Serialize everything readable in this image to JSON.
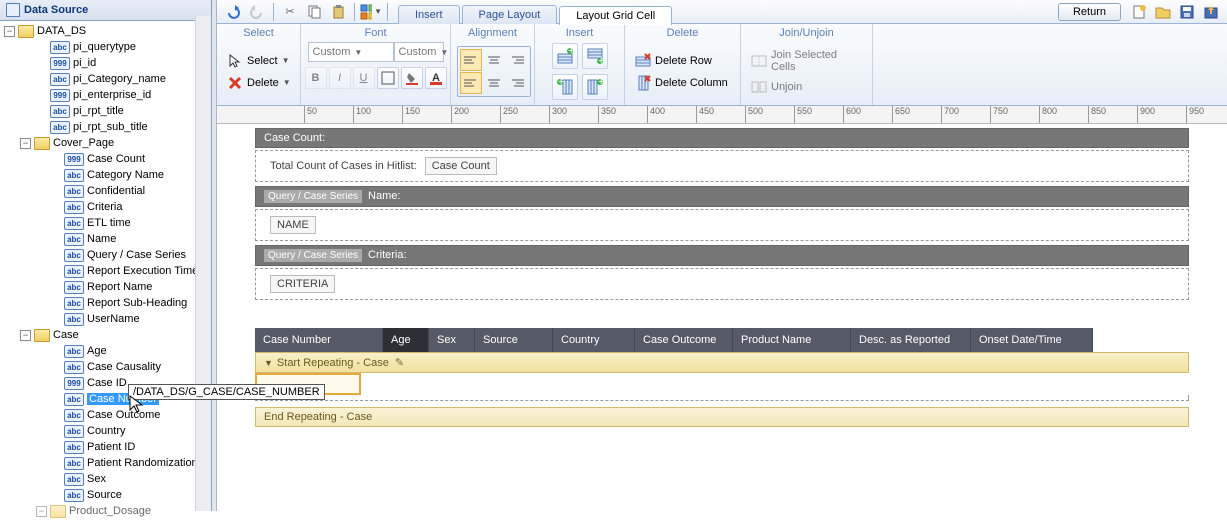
{
  "panel_title": "Data Source",
  "tree": {
    "root": "DATA_DS",
    "items_lvl1": [
      {
        "badge": "abc",
        "label": "pi_querytype"
      },
      {
        "badge": "999",
        "label": "pi_id"
      },
      {
        "badge": "abc",
        "label": "pi_Category_name"
      },
      {
        "badge": "999",
        "label": "pi_enterprise_id"
      },
      {
        "badge": "abc",
        "label": "pi_rpt_title"
      },
      {
        "badge": "abc",
        "label": "pi_rpt_sub_title"
      }
    ],
    "cover": "Cover_Page",
    "cover_items": [
      {
        "badge": "999",
        "label": "Case Count"
      },
      {
        "badge": "abc",
        "label": "Category Name"
      },
      {
        "badge": "abc",
        "label": "Confidential"
      },
      {
        "badge": "abc",
        "label": "Criteria"
      },
      {
        "badge": "abc",
        "label": "ETL time"
      },
      {
        "badge": "abc",
        "label": "Name"
      },
      {
        "badge": "abc",
        "label": "Query / Case Series"
      },
      {
        "badge": "abc",
        "label": "Report Execution Time"
      },
      {
        "badge": "abc",
        "label": "Report Name"
      },
      {
        "badge": "abc",
        "label": "Report Sub-Heading"
      },
      {
        "badge": "abc",
        "label": "UserName"
      }
    ],
    "case": "Case",
    "case_items": [
      {
        "badge": "abc",
        "label": "Age"
      },
      {
        "badge": "abc",
        "label": "Case Causality"
      },
      {
        "badge": "999",
        "label": "Case ID"
      },
      {
        "badge": "abc",
        "label": "Case Number",
        "selected": true
      },
      {
        "badge": "abc",
        "label": "Case Outcome"
      },
      {
        "badge": "abc",
        "label": "Country"
      },
      {
        "badge": "abc",
        "label": "Patient ID"
      },
      {
        "badge": "abc",
        "label": "Patient Randomization N"
      },
      {
        "badge": "abc",
        "label": "Sex"
      },
      {
        "badge": "abc",
        "label": "Source"
      }
    ],
    "next_folder": "Product_Dosage"
  },
  "path_tooltip": "/DATA_DS/G_CASE/CASE_NUMBER",
  "top_tabs": [
    "Insert",
    "Page Layout",
    "Layout Grid Cell"
  ],
  "active_tab_index": 2,
  "return_btn": "Return",
  "ribbon": {
    "groups": {
      "select": {
        "title": "Select",
        "select_btn": "Select",
        "delete_btn": "Delete"
      },
      "font": {
        "title": "Font",
        "combo1": "Custom",
        "combo2": "Custom"
      },
      "alignment": {
        "title": "Alignment"
      },
      "insert": {
        "title": "Insert"
      },
      "delete": {
        "title": "Delete",
        "row": "Delete Row",
        "col": "Delete Column"
      },
      "join": {
        "title": "Join/Unjoin",
        "join": "Join Selected Cells",
        "unjoin": "Unjoin"
      }
    }
  },
  "ruler_marks": [
    50,
    100,
    150,
    200,
    250,
    300,
    350,
    400,
    450,
    500,
    550,
    600,
    650,
    700,
    750,
    800,
    850,
    900,
    950
  ],
  "bands": {
    "case_count_head": "Case Count:",
    "case_count_body_label": "Total Count of Cases in Hitlist:",
    "case_count_field": "Case Count",
    "qcs_name_head_tag": "Query / Case Series",
    "qcs_name_head_lbl": "Name:",
    "qcs_name_field": "NAME",
    "qcs_crit_head_lbl": "Criteria:",
    "qcs_crit_field": "CRITERIA"
  },
  "table_columns": [
    "Case Number",
    "Age",
    "Sex",
    "Source",
    "Country",
    "Case Outcome",
    "Product Name",
    "Desc. as Reported",
    "Onset Date/Time"
  ],
  "repeat_start": "Start Repeating - Case",
  "repeat_end": "End Repeating - Case"
}
